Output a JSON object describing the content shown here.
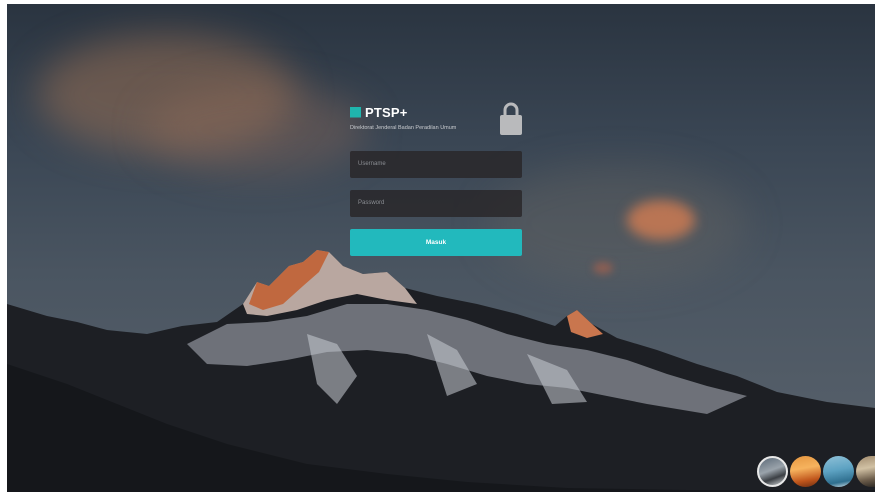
{
  "login": {
    "brand_name": "PTSP+",
    "brand_subtitle": "Direktorat Jenderal Badan Peradilan Umum",
    "username_placeholder": "Username",
    "password_placeholder": "Password",
    "submit_label": "Masuk"
  },
  "theme": {
    "accent": "#22b9bd",
    "field_background": "#282628"
  },
  "background_thumbnails": [
    "mountain-dusk",
    "desert-sunset",
    "blue-lake",
    "canyon"
  ]
}
